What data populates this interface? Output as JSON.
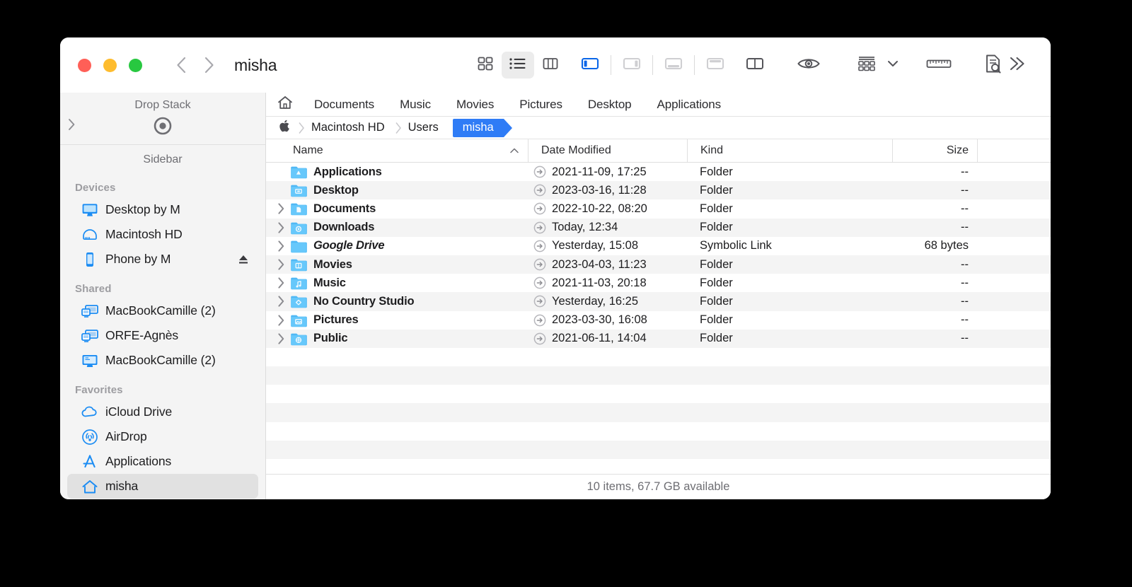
{
  "window": {
    "title": "misha",
    "traffic_lights": [
      "close",
      "minimize",
      "maximize"
    ],
    "back_label": "Back",
    "forward_label": "Forward"
  },
  "toolbar": {
    "view_icon_grid": "grid-view-icon",
    "view_icon_list": "list-view-icon",
    "view_icon_column": "column-view-icon",
    "pane_left": "sidebar-toggle-icon",
    "pane_right": "right-pane-toggle-icon",
    "pane_bottom": "bottom-pane-toggle-icon",
    "pane_top": "top-pane-toggle-icon",
    "pane_split": "split-pane-icon",
    "preview": "eye-icon",
    "arrange": "arrange-icon",
    "arrange_chevron": "chevron-down-icon",
    "ruler": "ruler-icon",
    "inspect": "document-search-icon",
    "overflow": "chevron-double-right-icon"
  },
  "sidebar": {
    "dropstack": {
      "title": "Drop Stack",
      "target_icon": "drop-target-icon",
      "collapse_icon": "chevron-right-icon"
    },
    "title": "Sidebar",
    "groups": [
      {
        "label": "Devices",
        "items": [
          {
            "label": "Desktop by M",
            "icon": "imac-icon",
            "eject": false,
            "selected": false
          },
          {
            "label": "Macintosh HD",
            "icon": "harddisk-icon",
            "eject": false,
            "selected": false
          },
          {
            "label": "Phone by M",
            "icon": "iphone-icon",
            "eject": true,
            "selected": false
          }
        ]
      },
      {
        "label": "Shared",
        "items": [
          {
            "label": "MacBookCamille (2)",
            "icon": "shared-screens-icon",
            "eject": false,
            "selected": false
          },
          {
            "label": "ORFE-Agnès",
            "icon": "shared-screens-icon",
            "eject": false,
            "selected": false
          },
          {
            "label": "MacBookCamille (2)",
            "icon": "shared-display-icon",
            "eject": false,
            "selected": false
          }
        ]
      },
      {
        "label": "Favorites",
        "items": [
          {
            "label": "iCloud Drive",
            "icon": "cloud-icon",
            "eject": false,
            "selected": false
          },
          {
            "label": "AirDrop",
            "icon": "airdrop-icon",
            "eject": false,
            "selected": false
          },
          {
            "label": "Applications",
            "icon": "appstore-a-icon",
            "eject": false,
            "selected": false
          },
          {
            "label": "misha",
            "icon": "home-icon",
            "eject": false,
            "selected": true
          }
        ]
      }
    ]
  },
  "favorites_bar": {
    "home_icon": "home-icon",
    "links": [
      "Documents",
      "Music",
      "Movies",
      "Pictures",
      "Desktop",
      "Applications"
    ]
  },
  "path_bar": {
    "apple_icon": "apple-logo-icon",
    "crumbs": [
      {
        "label": "Macintosh HD",
        "active": false
      },
      {
        "label": "Users",
        "active": false
      },
      {
        "label": "misha",
        "active": true
      }
    ]
  },
  "columns": [
    {
      "key": "name",
      "label": "Name",
      "sorted": true,
      "sort_icon": "chevron-up-icon"
    },
    {
      "key": "date",
      "label": "Date Modified",
      "sorted": false,
      "sort_icon": ""
    },
    {
      "key": "kind",
      "label": "Kind",
      "sorted": false,
      "sort_icon": ""
    },
    {
      "key": "size",
      "label": "Size",
      "sorted": false,
      "sort_icon": ""
    }
  ],
  "rows": [
    {
      "name": "Applications",
      "icon": "folder-applications-icon",
      "disclosure": false,
      "date": "2021-11-09, 17:25",
      "kind": "Folder",
      "size": "--",
      "symlink": false,
      "go_icon": "arrow-right-circle-icon"
    },
    {
      "name": "Desktop",
      "icon": "folder-desktop-icon",
      "disclosure": false,
      "date": "2023-03-16, 11:28",
      "kind": "Folder",
      "size": "--",
      "symlink": false,
      "go_icon": "arrow-right-circle-icon"
    },
    {
      "name": "Documents",
      "icon": "folder-documents-icon",
      "disclosure": true,
      "date": "2022-10-22, 08:20",
      "kind": "Folder",
      "size": "--",
      "symlink": false,
      "go_icon": "arrow-right-circle-icon"
    },
    {
      "name": "Downloads",
      "icon": "folder-downloads-icon",
      "disclosure": true,
      "date": "Today, 12:34",
      "kind": "Folder",
      "size": "--",
      "symlink": false,
      "go_icon": "arrow-right-circle-icon"
    },
    {
      "name": "Google Drive",
      "icon": "folder-plain-icon",
      "disclosure": true,
      "date": "Yesterday, 15:08",
      "kind": "Symbolic Link",
      "size": "68 bytes",
      "symlink": true,
      "go_icon": "arrow-right-circle-icon"
    },
    {
      "name": "Movies",
      "icon": "folder-movies-icon",
      "disclosure": true,
      "date": "2023-04-03, 11:23",
      "kind": "Folder",
      "size": "--",
      "symlink": false,
      "go_icon": "arrow-right-circle-icon"
    },
    {
      "name": "Music",
      "icon": "folder-music-icon",
      "disclosure": true,
      "date": "2021-11-03, 20:18",
      "kind": "Folder",
      "size": "--",
      "symlink": false,
      "go_icon": "arrow-right-circle-icon"
    },
    {
      "name": "No Country Studio",
      "icon": "folder-dropbox-icon",
      "disclosure": true,
      "date": "Yesterday, 16:25",
      "kind": "Folder",
      "size": "--",
      "symlink": false,
      "go_icon": "arrow-right-circle-icon"
    },
    {
      "name": "Pictures",
      "icon": "folder-pictures-icon",
      "disclosure": true,
      "date": "2023-03-30, 16:08",
      "kind": "Folder",
      "size": "--",
      "symlink": false,
      "go_icon": "arrow-right-circle-icon"
    },
    {
      "name": "Public",
      "icon": "folder-public-icon",
      "disclosure": true,
      "date": "2021-06-11, 14:04",
      "kind": "Folder",
      "size": "--",
      "symlink": false,
      "go_icon": "arrow-right-circle-icon"
    }
  ],
  "empty_rows": 6,
  "status": {
    "text": "10 items, 67.7 GB available"
  },
  "colors": {
    "accent": "#2f7cf6",
    "folder_blue": "#5ac0fa",
    "stripe": "#f4f4f4",
    "sidebar_bg": "#f4f4f4",
    "selected_sidebar": "#e1e1e1",
    "text": "#1d1d1f",
    "muted": "#6e6e73",
    "close": "#ff5f57",
    "minimize": "#febc2e",
    "maximize": "#28c840"
  }
}
